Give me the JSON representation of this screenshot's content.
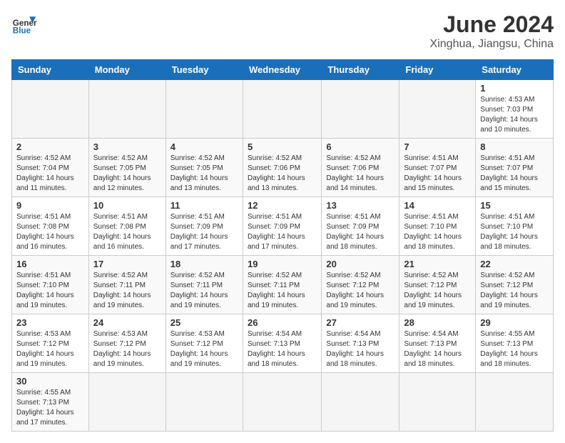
{
  "header": {
    "logo_general": "General",
    "logo_blue": "Blue",
    "month_title": "June 2024",
    "location": "Xinghua, Jiangsu, China"
  },
  "weekdays": [
    "Sunday",
    "Monday",
    "Tuesday",
    "Wednesday",
    "Thursday",
    "Friday",
    "Saturday"
  ],
  "weeks": [
    [
      {
        "day": "",
        "info": ""
      },
      {
        "day": "",
        "info": ""
      },
      {
        "day": "",
        "info": ""
      },
      {
        "day": "",
        "info": ""
      },
      {
        "day": "",
        "info": ""
      },
      {
        "day": "",
        "info": ""
      },
      {
        "day": "1",
        "info": "Sunrise: 4:53 AM\nSunset: 7:03 PM\nDaylight: 14 hours\nand 10 minutes."
      }
    ],
    [
      {
        "day": "2",
        "info": "Sunrise: 4:52 AM\nSunset: 7:04 PM\nDaylight: 14 hours\nand 11 minutes."
      },
      {
        "day": "3",
        "info": "Sunrise: 4:52 AM\nSunset: 7:05 PM\nDaylight: 14 hours\nand 12 minutes."
      },
      {
        "day": "4",
        "info": "Sunrise: 4:52 AM\nSunset: 7:05 PM\nDaylight: 14 hours\nand 13 minutes."
      },
      {
        "day": "5",
        "info": "Sunrise: 4:52 AM\nSunset: 7:06 PM\nDaylight: 14 hours\nand 13 minutes."
      },
      {
        "day": "6",
        "info": "Sunrise: 4:52 AM\nSunset: 7:06 PM\nDaylight: 14 hours\nand 14 minutes."
      },
      {
        "day": "7",
        "info": "Sunrise: 4:51 AM\nSunset: 7:07 PM\nDaylight: 14 hours\nand 15 minutes."
      },
      {
        "day": "8",
        "info": "Sunrise: 4:51 AM\nSunset: 7:07 PM\nDaylight: 14 hours\nand 15 minutes."
      }
    ],
    [
      {
        "day": "9",
        "info": "Sunrise: 4:51 AM\nSunset: 7:08 PM\nDaylight: 14 hours\nand 16 minutes."
      },
      {
        "day": "10",
        "info": "Sunrise: 4:51 AM\nSunset: 7:08 PM\nDaylight: 14 hours\nand 16 minutes."
      },
      {
        "day": "11",
        "info": "Sunrise: 4:51 AM\nSunset: 7:09 PM\nDaylight: 14 hours\nand 17 minutes."
      },
      {
        "day": "12",
        "info": "Sunrise: 4:51 AM\nSunset: 7:09 PM\nDaylight: 14 hours\nand 17 minutes."
      },
      {
        "day": "13",
        "info": "Sunrise: 4:51 AM\nSunset: 7:09 PM\nDaylight: 14 hours\nand 18 minutes."
      },
      {
        "day": "14",
        "info": "Sunrise: 4:51 AM\nSunset: 7:10 PM\nDaylight: 14 hours\nand 18 minutes."
      },
      {
        "day": "15",
        "info": "Sunrise: 4:51 AM\nSunset: 7:10 PM\nDaylight: 14 hours\nand 18 minutes."
      }
    ],
    [
      {
        "day": "16",
        "info": "Sunrise: 4:51 AM\nSunset: 7:10 PM\nDaylight: 14 hours\nand 19 minutes."
      },
      {
        "day": "17",
        "info": "Sunrise: 4:52 AM\nSunset: 7:11 PM\nDaylight: 14 hours\nand 19 minutes."
      },
      {
        "day": "18",
        "info": "Sunrise: 4:52 AM\nSunset: 7:11 PM\nDaylight: 14 hours\nand 19 minutes."
      },
      {
        "day": "19",
        "info": "Sunrise: 4:52 AM\nSunset: 7:11 PM\nDaylight: 14 hours\nand 19 minutes."
      },
      {
        "day": "20",
        "info": "Sunrise: 4:52 AM\nSunset: 7:12 PM\nDaylight: 14 hours\nand 19 minutes."
      },
      {
        "day": "21",
        "info": "Sunrise: 4:52 AM\nSunset: 7:12 PM\nDaylight: 14 hours\nand 19 minutes."
      },
      {
        "day": "22",
        "info": "Sunrise: 4:52 AM\nSunset: 7:12 PM\nDaylight: 14 hours\nand 19 minutes."
      }
    ],
    [
      {
        "day": "23",
        "info": "Sunrise: 4:53 AM\nSunset: 7:12 PM\nDaylight: 14 hours\nand 19 minutes."
      },
      {
        "day": "24",
        "info": "Sunrise: 4:53 AM\nSunset: 7:12 PM\nDaylight: 14 hours\nand 19 minutes."
      },
      {
        "day": "25",
        "info": "Sunrise: 4:53 AM\nSunset: 7:12 PM\nDaylight: 14 hours\nand 19 minutes."
      },
      {
        "day": "26",
        "info": "Sunrise: 4:54 AM\nSunset: 7:13 PM\nDaylight: 14 hours\nand 18 minutes."
      },
      {
        "day": "27",
        "info": "Sunrise: 4:54 AM\nSunset: 7:13 PM\nDaylight: 14 hours\nand 18 minutes."
      },
      {
        "day": "28",
        "info": "Sunrise: 4:54 AM\nSunset: 7:13 PM\nDaylight: 14 hours\nand 18 minutes."
      },
      {
        "day": "29",
        "info": "Sunrise: 4:55 AM\nSunset: 7:13 PM\nDaylight: 14 hours\nand 18 minutes."
      }
    ],
    [
      {
        "day": "30",
        "info": "Sunrise: 4:55 AM\nSunset: 7:13 PM\nDaylight: 14 hours\nand 17 minutes."
      },
      {
        "day": "",
        "info": ""
      },
      {
        "day": "",
        "info": ""
      },
      {
        "day": "",
        "info": ""
      },
      {
        "day": "",
        "info": ""
      },
      {
        "day": "",
        "info": ""
      },
      {
        "day": "",
        "info": ""
      }
    ]
  ]
}
